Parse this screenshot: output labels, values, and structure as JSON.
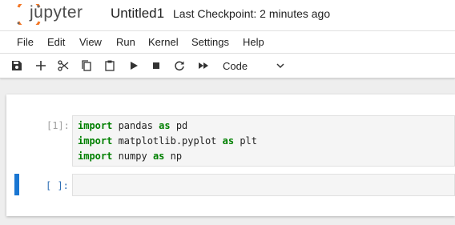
{
  "header": {
    "logo_text": "jupyter",
    "notebook_title": "Untitled1",
    "checkpoint": "Last Checkpoint: 2 minutes ago"
  },
  "menu": [
    "File",
    "Edit",
    "View",
    "Run",
    "Kernel",
    "Settings",
    "Help"
  ],
  "toolbar": {
    "buttons": [
      "save-icon",
      "add-icon",
      "cut-icon",
      "copy-icon",
      "paste-icon",
      "run-icon",
      "stop-icon",
      "restart-icon",
      "fast-forward-icon",
      "chevron-down-icon"
    ],
    "cell_type": "Code"
  },
  "cells": [
    {
      "prompt": "[1]:",
      "lines": [
        [
          "import",
          " pandas ",
          "as",
          " pd"
        ],
        [
          "import",
          " matplotlib.pyplot ",
          "as",
          " plt"
        ],
        [
          "import",
          " numpy ",
          "as",
          " np"
        ]
      ]
    },
    {
      "prompt": "[ ]:",
      "lines": []
    }
  ],
  "colors": {
    "accent": "#1976d2",
    "keyword": "#008000",
    "logo_orange": "#f37726"
  }
}
